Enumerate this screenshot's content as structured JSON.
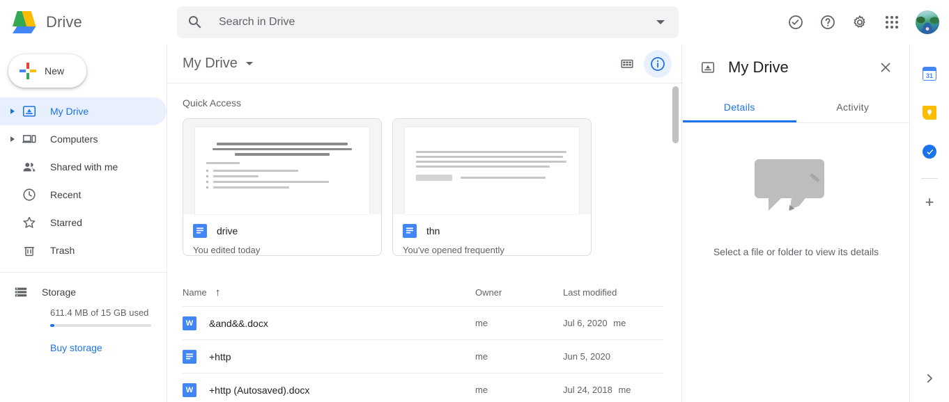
{
  "header": {
    "app_name": "Drive",
    "logo_icon": "google-drive-logo",
    "search": {
      "placeholder": "Search in Drive",
      "value": "",
      "search_icon": "search-icon",
      "options_icon": "chevron-down-icon"
    },
    "icons": [
      {
        "name": "support-icon",
        "label": "Support"
      },
      {
        "name": "help-icon",
        "label": "Help"
      },
      {
        "name": "settings-gear-icon",
        "label": "Settings"
      },
      {
        "name": "google-apps-grid-icon",
        "label": "Google apps"
      },
      {
        "name": "account-avatar",
        "label": "Google Account"
      }
    ]
  },
  "sidebar": {
    "new_button": {
      "label": "New",
      "icon": "google-plus-icon"
    },
    "items": [
      {
        "label": "My Drive",
        "icon": "my-drive-icon",
        "active": true,
        "expandable": true
      },
      {
        "label": "Computers",
        "icon": "computers-icon",
        "active": false,
        "expandable": true
      },
      {
        "label": "Shared with me",
        "icon": "shared-with-me-icon",
        "active": false,
        "expandable": false
      },
      {
        "label": "Recent",
        "icon": "clock-icon",
        "active": false,
        "expandable": false
      },
      {
        "label": "Starred",
        "icon": "star-icon",
        "active": false,
        "expandable": false
      },
      {
        "label": "Trash",
        "icon": "trash-icon",
        "active": false,
        "expandable": false
      }
    ],
    "storage": {
      "label": "Storage",
      "icon": "storage-icon",
      "used_text": "611.4 MB of 15 GB used",
      "used_percent": 4,
      "buy_label": "Buy storage",
      "bar_fill_color": "#1a73e8"
    }
  },
  "main": {
    "breadcrumb": "My Drive",
    "breadcrumb_caret": "chevron-down-icon",
    "view_toggle_icon": "grid-view-icon",
    "details_toggle_icon": "info-icon",
    "details_toggle_active": true,
    "quick_access": {
      "title": "Quick Access",
      "cards": [
        {
          "name": "drive",
          "subtitle": "You edited today",
          "icon": "google-docs-icon"
        },
        {
          "name": "thn",
          "subtitle": "You've opened frequently",
          "icon": "google-docs-icon"
        }
      ]
    },
    "file_table": {
      "columns": [
        "Name",
        "Owner",
        "Last modified"
      ],
      "sort_column": "Name",
      "sort_direction_icon": "arrow-up-icon",
      "rows": [
        {
          "name": "&and&&.docx",
          "icon": "word-doc-icon",
          "icon_letter": "W",
          "owner": "me",
          "modified": "Jul 6, 2020",
          "modified_by": "me"
        },
        {
          "name": "+http",
          "icon": "google-docs-icon",
          "icon_letter": "",
          "owner": "me",
          "modified": "Jun 5, 2020",
          "modified_by": ""
        },
        {
          "name": "+http (Autosaved).docx",
          "icon": "word-doc-icon",
          "icon_letter": "W",
          "owner": "me",
          "modified": "Jul 24, 2018",
          "modified_by": "me"
        }
      ]
    }
  },
  "details_panel": {
    "title": "My Drive",
    "title_icon": "my-drive-icon",
    "close_icon": "close-icon",
    "tabs": [
      {
        "label": "Details",
        "active": true
      },
      {
        "label": "Activity",
        "active": false
      }
    ],
    "empty_state": {
      "text": "Select a file or folder to view its details",
      "illustration": "speech-bubble-pencil-illustration"
    }
  },
  "right_rail": {
    "items": [
      {
        "name": "google-calendar-icon",
        "label": "Calendar",
        "badge": "31"
      },
      {
        "name": "google-keep-icon",
        "label": "Keep",
        "badge": ""
      },
      {
        "name": "google-tasks-icon",
        "label": "Tasks",
        "badge": ""
      }
    ],
    "add_icon": "plus-icon",
    "expand_icon": "chevron-right-icon"
  },
  "colors": {
    "accent": "#1a73e8",
    "accent_bg": "#e8f0fe",
    "text_primary": "#202124",
    "text_secondary": "#5f6368",
    "border": "#e8eaed",
    "search_bg": "#f1f3f4"
  }
}
